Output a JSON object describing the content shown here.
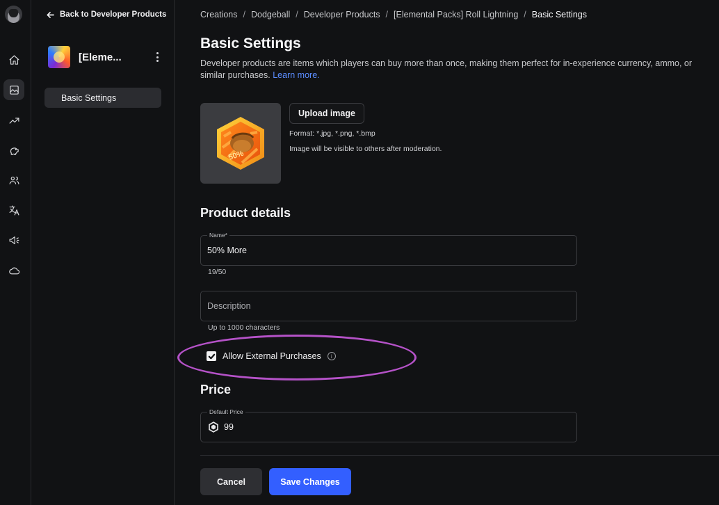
{
  "sidebar": {
    "back_label": "Back to Developer Products",
    "product_name": "[Eleme...",
    "items": [
      {
        "label": "Basic Settings",
        "active": true
      }
    ]
  },
  "rail": {
    "icons": [
      "avatar",
      "home-icon",
      "creations-icon",
      "analytics-icon",
      "monetization-icon",
      "people-icon",
      "translate-icon",
      "ads-icon",
      "cloud-icon"
    ],
    "active": "creations-icon"
  },
  "breadcrumbs": [
    "Creations",
    "Dodgeball",
    "Developer Products",
    "[Elemental Packs] Roll Lightning",
    "Basic Settings"
  ],
  "page": {
    "title": "Basic Settings",
    "description": "Developer products are items which players can buy more than once, making them perfect for in-experience currency, ammo, or similar purchases.",
    "learn_more": "Learn more."
  },
  "image": {
    "upload_label": "Upload image",
    "format": "Format: *.jpg, *.png, *.bmp",
    "note": "Image will be visible to others after moderation.",
    "badge_text": "50%"
  },
  "details": {
    "heading": "Product details",
    "name_label": "Name*",
    "name_value": "50% More",
    "name_count": "19/50",
    "description_placeholder": "Description",
    "description_hint": "Up to 1000 characters",
    "allow_external_label": "Allow External Purchases",
    "allow_external_checked": true
  },
  "price": {
    "heading": "Price",
    "default_label": "Default Price",
    "value": "99"
  },
  "actions": {
    "cancel": "Cancel",
    "save": "Save Changes"
  },
  "colors": {
    "accent": "#335fff",
    "link": "#5b8dff",
    "highlight_ellipse": "#b552c8"
  }
}
